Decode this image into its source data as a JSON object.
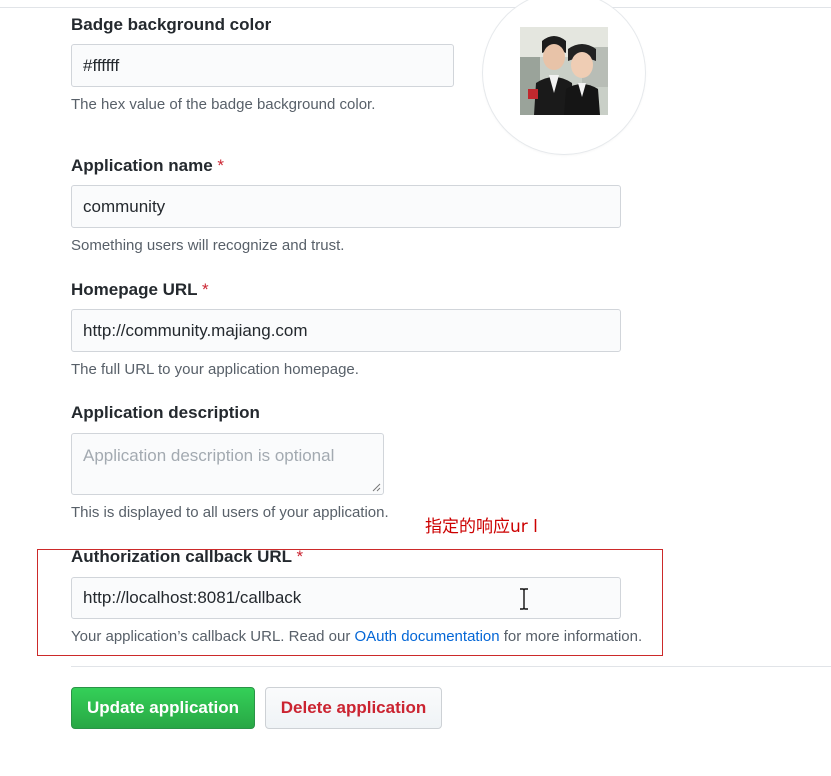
{
  "badge": {
    "label": "Badge background color",
    "value": "#ffffff",
    "note": "The hex value of the badge background color."
  },
  "app_name": {
    "label": "Application name",
    "required_mark": "*",
    "value": "community",
    "note": "Something users will recognize and trust."
  },
  "homepage": {
    "label": "Homepage URL",
    "required_mark": "*",
    "value": "http://community.majiang.com",
    "note": "The full URL to your application homepage."
  },
  "description": {
    "label": "Application description",
    "placeholder": "Application description is optional",
    "note": "This is displayed to all users of your application."
  },
  "callback": {
    "label": "Authorization callback URL",
    "required_mark": "*",
    "value": "http://localhost:8081/callback",
    "note_before": "Your application’s callback URL. Read our ",
    "note_link": "OAuth documentation",
    "note_after": " for more information."
  },
  "annotation": {
    "text": "指定的响应ur l",
    "color": "#cc0000"
  },
  "buttons": {
    "update": "Update application",
    "delete": "Delete application"
  },
  "colors": {
    "primary_green": "#28a745",
    "danger_red": "#cb2431",
    "link_blue": "#0366d6"
  }
}
